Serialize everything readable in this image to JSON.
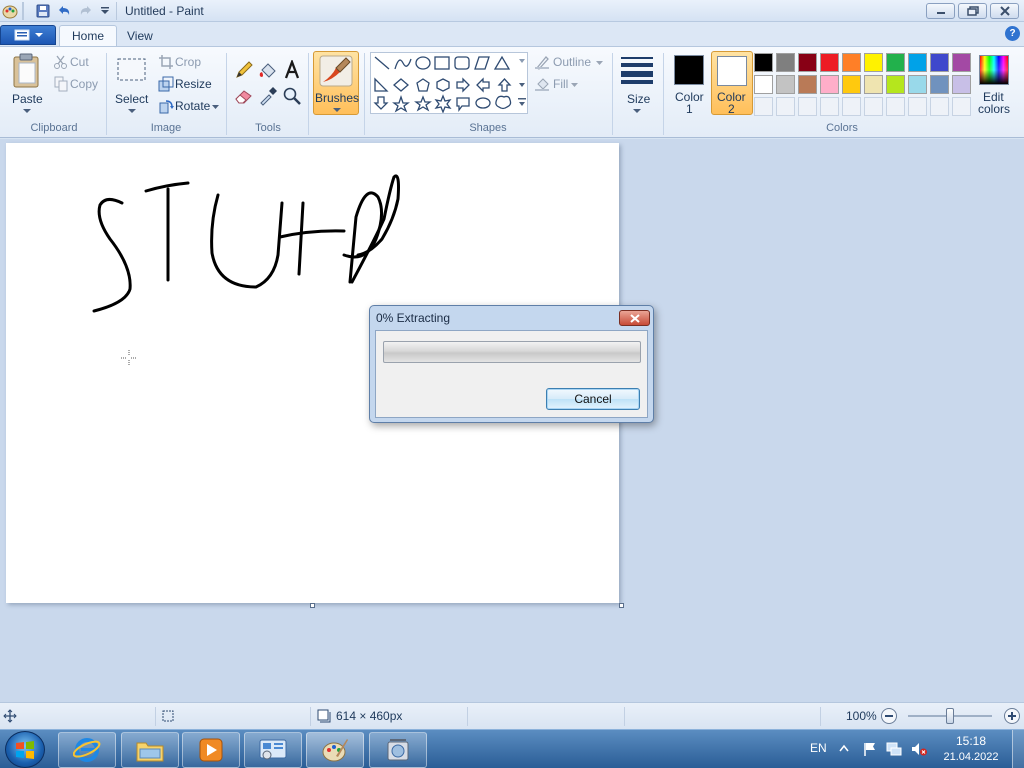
{
  "window": {
    "title": "Untitled - Paint"
  },
  "tabs": [
    {
      "label": "Home"
    },
    {
      "label": "View"
    }
  ],
  "clipboard": {
    "paste": "Paste",
    "cut": "Cut",
    "copy": "Copy",
    "group": "Clipboard"
  },
  "image": {
    "select": "Select",
    "crop": "Crop",
    "resize": "Resize",
    "rotate": "Rotate",
    "group": "Image"
  },
  "tools": {
    "group": "Tools"
  },
  "brushes": {
    "label": "Brushes"
  },
  "shapes": {
    "outline": "Outline",
    "fill": "Fill",
    "group": "Shapes"
  },
  "size": {
    "label": "Size"
  },
  "colors": {
    "color1_line1": "Color",
    "color1_line2": "1",
    "color2_line1": "Color",
    "color2_line2": "2",
    "edit_line1": "Edit",
    "edit_line2": "colors",
    "group": "Colors",
    "color1": "#000000",
    "color2": "#ffffff",
    "palette_row1": [
      "#000000",
      "#7f7f7f",
      "#880015",
      "#ed1c24",
      "#ff7f27",
      "#fff200",
      "#22b14c",
      "#00a2e8",
      "#3f48cc",
      "#a349a4"
    ],
    "palette_row2": [
      "#ffffff",
      "#c3c3c3",
      "#b97a57",
      "#ffaec9",
      "#ffc90e",
      "#efe4b0",
      "#b5e61d",
      "#99d9ea",
      "#7092be",
      "#c8bfe7"
    ]
  },
  "dialog": {
    "title": "0% Extracting",
    "cancel": "Cancel",
    "progress": 0
  },
  "status": {
    "dimensions": "614 × 460px",
    "zoom": "100%"
  },
  "taskbar": {
    "language": "EN",
    "time": "15:18",
    "date": "21.04.2022"
  }
}
